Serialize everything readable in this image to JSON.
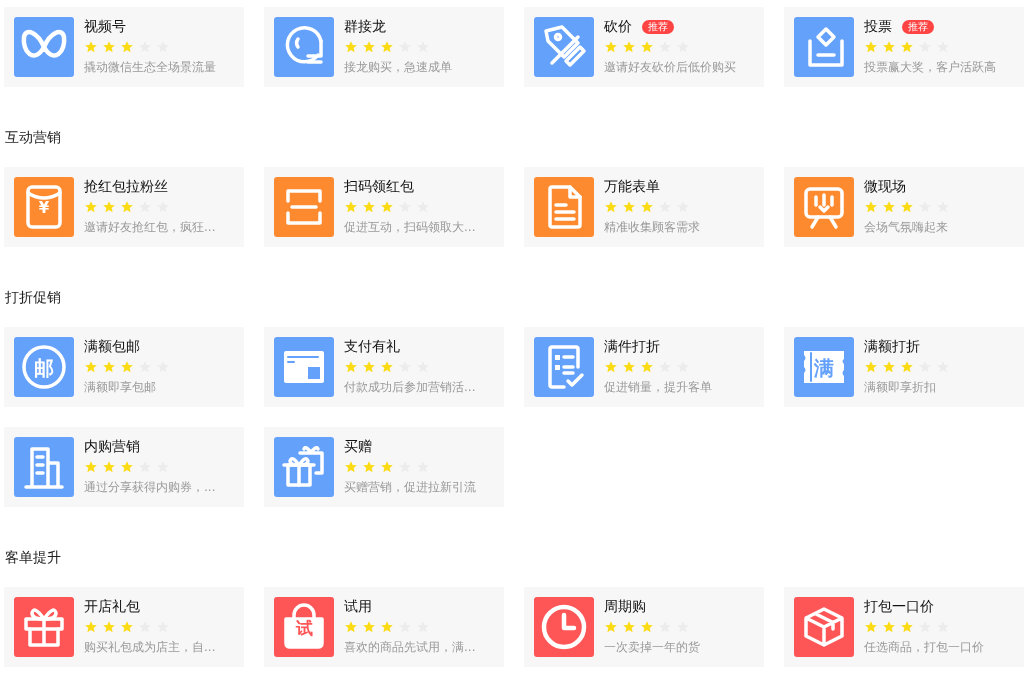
{
  "sections": [
    {
      "cards": [
        {
          "color": "#64a1fb",
          "title": "视频号",
          "stars": 3,
          "description": "撬动微信生态全场景流量"
        },
        {
          "color": "#64a1fb",
          "title": "群接龙",
          "stars": 3,
          "description": "接龙购买，急速成单"
        },
        {
          "color": "#64a1fb",
          "title": "砍价",
          "badge": "推荐",
          "stars": 3,
          "description": "邀请好友砍价后低价购买"
        },
        {
          "color": "#64a1fb",
          "title": "投票",
          "badge": "推荐",
          "stars": 3,
          "description": "投票赢大奖，客户活跃高"
        }
      ]
    },
    {
      "title": "互动营销",
      "cards": [
        {
          "glyph": "¥",
          "color": "#fe8a2f",
          "title": "抢红包拉粉丝",
          "stars": 3,
          "description": "邀请好友抢红包，疯狂..."
        },
        {
          "color": "#fe8a2f",
          "title": "扫码领红包",
          "stars": 3,
          "description": "促进互动，扫码领取大..."
        },
        {
          "color": "#fe8a2f",
          "title": "万能表单",
          "stars": 3,
          "description": "精准收集顾客需求"
        },
        {
          "color": "#fe8a2f",
          "title": "微现场",
          "stars": 3,
          "description": "会场气氛嗨起来"
        }
      ]
    },
    {
      "title": "打折促销",
      "cards": [
        {
          "glyph": "邮",
          "color": "#64a1fb",
          "title": "满额包邮",
          "stars": 3,
          "description": "满额即享包邮"
        },
        {
          "color": "#64a1fb",
          "title": "支付有礼",
          "stars": 3,
          "description": "付款成功后参加营销活..."
        },
        {
          "color": "#64a1fb",
          "title": "满件打折",
          "stars": 3,
          "description": "促进销量，提升客单"
        },
        {
          "glyph": "满",
          "color": "#64a1fb",
          "title": "满额打折",
          "stars": 3,
          "description": "满额即享折扣"
        },
        {
          "color": "#64a1fb",
          "title": "内购营销",
          "stars": 3,
          "description": "通过分享获得内购券，..."
        },
        {
          "color": "#64a1fb",
          "title": "买赠",
          "stars": 3,
          "description": "买赠营销，促进拉新引流"
        }
      ]
    },
    {
      "title": "客单提升",
      "cards": [
        {
          "color": "#fe5656",
          "title": "开店礼包",
          "stars": 3,
          "description": "购买礼包成为店主，自..."
        },
        {
          "glyph": "试",
          "color": "#fe5656",
          "title": "试用",
          "stars": 3,
          "description": "喜欢的商品先试用，满..."
        },
        {
          "color": "#fe5656",
          "title": "周期购",
          "stars": 3,
          "description": "一次卖掉一年的货"
        },
        {
          "color": "#fe5656",
          "title": "打包一口价",
          "stars": 3,
          "description": "任选商品，打包一口价"
        }
      ]
    }
  ]
}
